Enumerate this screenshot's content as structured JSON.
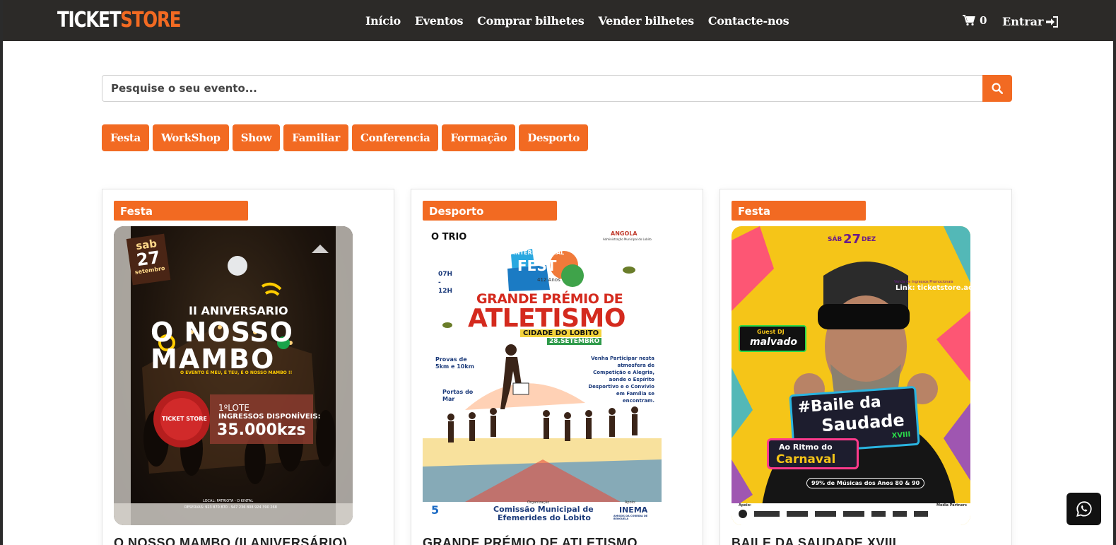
{
  "brand": {
    "part1": "TICKET",
    "part2": "STORE",
    "accent_color": "#f26a22",
    "navbar_color": "#2c2a28"
  },
  "nav": {
    "items": [
      "Início",
      "Eventos",
      "Comprar bilhetes",
      "Vender bilhetes",
      "Contacte-nos"
    ]
  },
  "cart": {
    "icon": "cart-icon",
    "count": "0"
  },
  "login": {
    "label": "Entrar",
    "icon": "sign-in-icon"
  },
  "search": {
    "placeholder": "Pesquise o seu evento...",
    "value": "",
    "icon": "search-icon"
  },
  "categories": [
    "Festa",
    "WorkShop",
    "Show",
    "Familiar",
    "Conferencia",
    "Formação",
    "Desporto"
  ],
  "events": [
    {
      "category": "Festa",
      "title": "O NOSSO MAMBO (II ANIVERSÁRIO)",
      "poster": {
        "date_day": "sab",
        "date_num": "27",
        "date_month": "setembro",
        "line1": "II ANIVERSARIO",
        "line2": "O NOSSO",
        "line3": "MAMBO",
        "tagline": "O EVENTO É MEU, É TEU, É O NOSSO MAMBO !!",
        "seal": "TICKET STORE",
        "lote": "1ºLOTE",
        "ingressos": "INGRESSOS DISPONÍVEIS:",
        "price": "35.000kzs",
        "local": "LOCAL: PATRIOTA - O KINTAL",
        "reservas": "RESERVAS: 923 870 870 · 947 236 808 924 390 268"
      }
    },
    {
      "category": "Desporto",
      "title": "GRANDE PRÉMIO DE ATLETISMO",
      "poster": {
        "top_left": "O TRIO",
        "fest1": "LOBITO",
        "fest2": "INTERNATIONAL",
        "fest3": "FEST",
        "anos": "412 Anos",
        "time": "07H - 12H",
        "angola": "ANGOLA",
        "admin": "Administração Municipal do Lobito",
        "gp": "GRANDE PRÉMIO DE",
        "atletismo": "ATLETISMO",
        "cidade": "CIDADE DO LOBITO",
        "data": "28.SETEMBRO",
        "provas": "Provas de 5km e 10km",
        "local": "Portas do Mar",
        "desc": "Venha Participar nesta atmosfera de Competição e Alegria, aonde o Espírito Desportivo e o Convívio em Família se encontram.",
        "org": "Organização",
        "comissao1": "Comissão Municipal de",
        "comissao2": "Efemerides do Lobito",
        "apoio": "Apoio:",
        "inema": "INEMA",
        "inema_sub": "AMIGOS DA CORRIDA DE BENGUELA"
      }
    },
    {
      "category": "Festa",
      "title": "BAILE DA SAUDADE XVIII",
      "poster": {
        "date_pre": "SÁB",
        "date_num": "27",
        "date_month": "DEZ",
        "venda": "Venda de Ingressos Promocionais",
        "link": "Link: ticketstore.ao",
        "guest1": "Guest DJ",
        "guest2": "malvado",
        "baile1": "#Baile da",
        "baile2": "Saudade",
        "edicao": "XVIII",
        "ritmo": "Ao Ritmo do",
        "carnaval": "Carnaval",
        "musicas": "99% de Músicas dos Anos 80 & 90",
        "apoio": "Apoio:",
        "media": "Media Partners"
      }
    }
  ],
  "whatsapp": {
    "icon": "whatsapp-icon"
  }
}
